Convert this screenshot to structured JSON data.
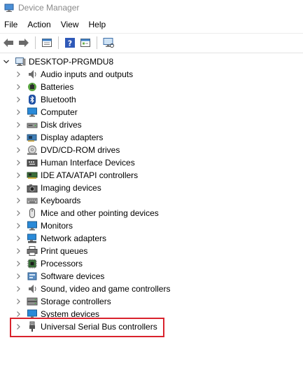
{
  "window": {
    "title": "Device Manager"
  },
  "menu": [
    "File",
    "Action",
    "View",
    "Help"
  ],
  "toolbar": {
    "buttons": [
      "back-arrow-icon",
      "forward-arrow-icon",
      "properties-icon",
      "help-icon",
      "show-hidden-icon",
      "monitor-scan-icon"
    ]
  },
  "tree": {
    "root": "DESKTOP-PRGMDU8",
    "items": [
      {
        "label": "Audio inputs and outputs",
        "icon": "speaker-icon"
      },
      {
        "label": "Batteries",
        "icon": "battery-icon"
      },
      {
        "label": "Bluetooth",
        "icon": "bluetooth-icon"
      },
      {
        "label": "Computer",
        "icon": "computer-icon"
      },
      {
        "label": "Disk drives",
        "icon": "disk-drive-icon"
      },
      {
        "label": "Display adapters",
        "icon": "display-adapter-icon"
      },
      {
        "label": "DVD/CD-ROM drives",
        "icon": "dvd-icon"
      },
      {
        "label": "Human Interface Devices",
        "icon": "hid-icon"
      },
      {
        "label": "IDE ATA/ATAPI controllers",
        "icon": "ide-controller-icon"
      },
      {
        "label": "Imaging devices",
        "icon": "camera-icon"
      },
      {
        "label": "Keyboards",
        "icon": "keyboard-icon"
      },
      {
        "label": "Mice and other pointing devices",
        "icon": "mouse-icon"
      },
      {
        "label": "Monitors",
        "icon": "monitor-icon"
      },
      {
        "label": "Network adapters",
        "icon": "network-adapter-icon"
      },
      {
        "label": "Print queues",
        "icon": "printer-icon"
      },
      {
        "label": "Processors",
        "icon": "processor-icon"
      },
      {
        "label": "Software devices",
        "icon": "software-device-icon"
      },
      {
        "label": "Sound, video and game controllers",
        "icon": "sound-controller-icon"
      },
      {
        "label": "Storage controllers",
        "icon": "storage-controller-icon"
      },
      {
        "label": "System devices",
        "icon": "system-device-icon"
      },
      {
        "label": "Universal Serial Bus controllers",
        "icon": "usb-icon"
      }
    ]
  },
  "colors": {
    "highlight": "#d9232d",
    "title_text": "#8a8a8a"
  }
}
